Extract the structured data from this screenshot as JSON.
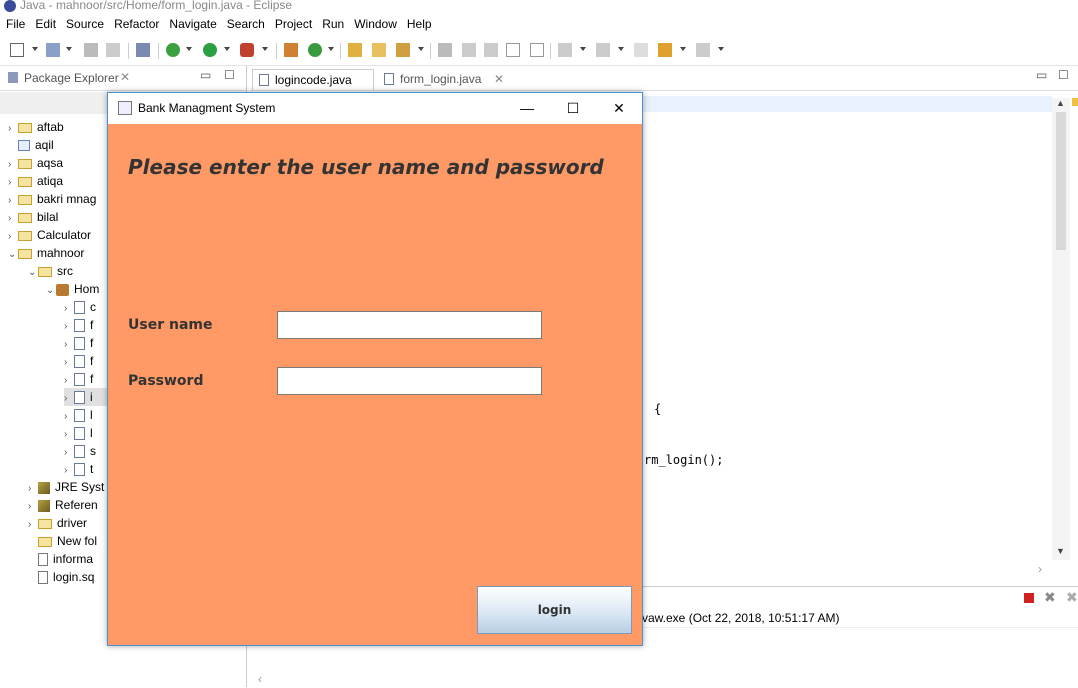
{
  "window": {
    "title": "Java - mahnoor/src/Home/form_login.java - Eclipse"
  },
  "menubar": {
    "items": [
      "File",
      "Edit",
      "Source",
      "Refactor",
      "Navigate",
      "Search",
      "Project",
      "Run",
      "Window",
      "Help"
    ]
  },
  "package_explorer": {
    "title": "Package Explorer",
    "tree": [
      {
        "label": "aftab"
      },
      {
        "label": "aqil"
      },
      {
        "label": "aqsa"
      },
      {
        "label": "atiqa"
      },
      {
        "label": "bakri mnag"
      },
      {
        "label": "bilal"
      },
      {
        "label": "Calculator"
      },
      {
        "label": "mahnoor"
      },
      {
        "label": "src"
      },
      {
        "label": "Hom"
      },
      {
        "label": "c"
      },
      {
        "label": "f"
      },
      {
        "label": "f"
      },
      {
        "label": "f"
      },
      {
        "label": "f"
      },
      {
        "label": "i"
      },
      {
        "label": "l"
      },
      {
        "label": "l"
      },
      {
        "label": "s"
      },
      {
        "label": "t"
      },
      {
        "label": "JRE Syst"
      },
      {
        "label": "Referen"
      },
      {
        "label": "driver"
      },
      {
        "label": "New fol"
      },
      {
        "label": "informa"
      },
      {
        "label": "login.sq"
      }
    ]
  },
  "editor": {
    "tabs": [
      "logincode.java",
      "form_login.java"
    ],
    "code_fragments": [
      "{",
      "rm_login();"
    ],
    "console_text": "vaw.exe (Oct 22, 2018, 10:51:17 AM)"
  },
  "dialog": {
    "title": "Bank Managment System",
    "heading": "Please enter the user name and password",
    "username_label": "User name",
    "password_label": "Password",
    "username_value": "",
    "password_value": "",
    "login_label": "login",
    "minimize": "—",
    "maximize": "☐",
    "close": "✕",
    "bg_color": "#ff9966"
  }
}
